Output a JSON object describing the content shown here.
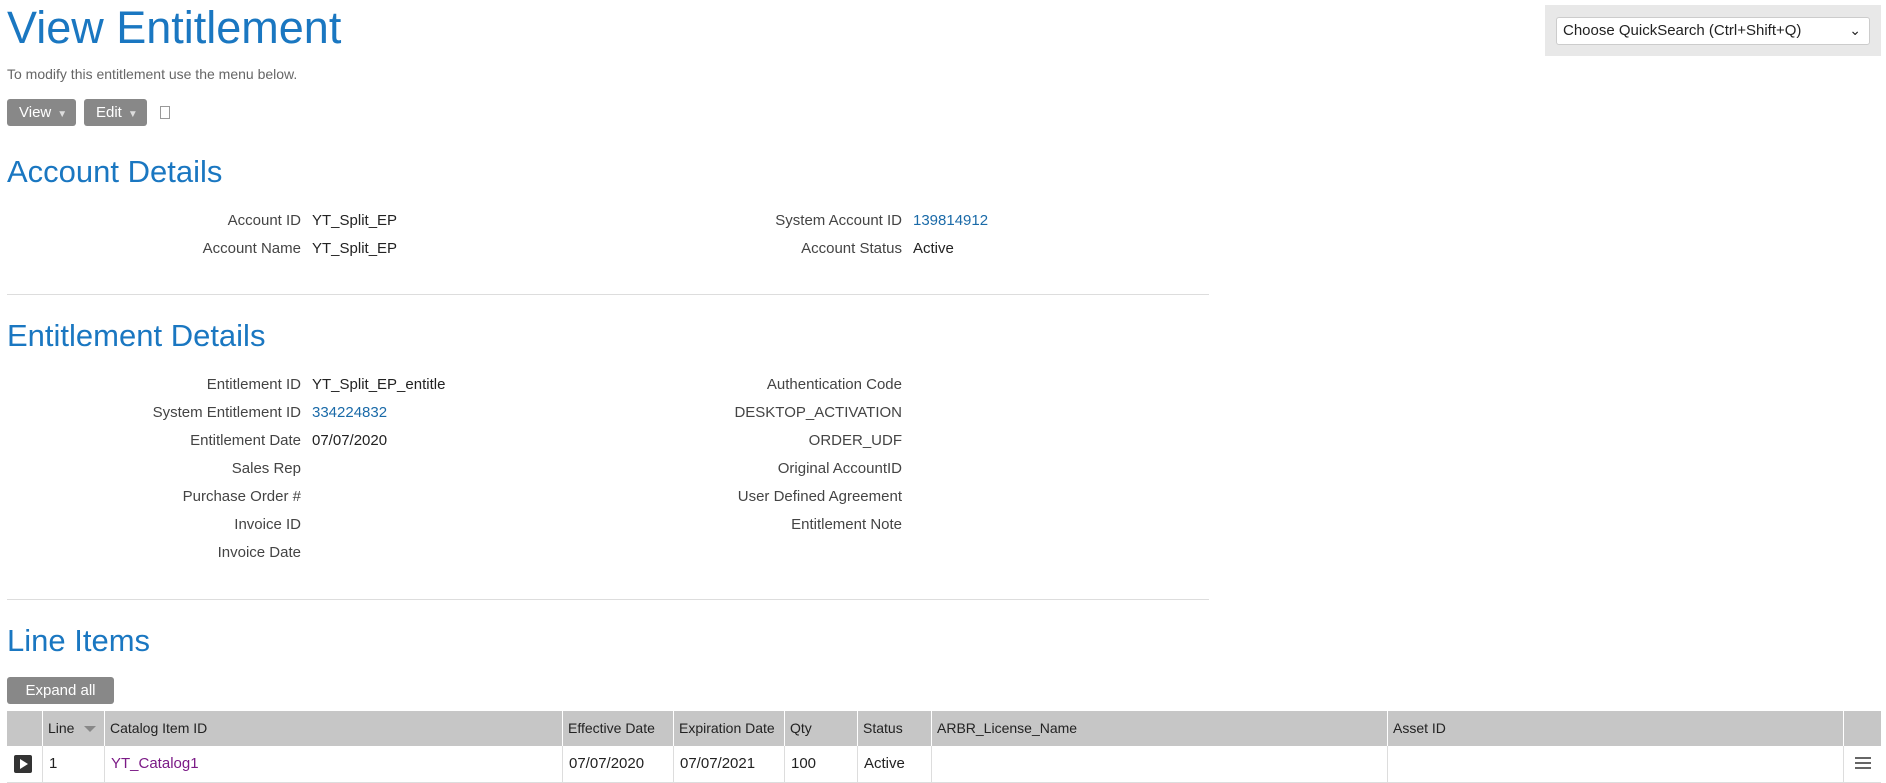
{
  "page": {
    "title": "View Entitlement",
    "subtitle": "To modify this entitlement use the menu below."
  },
  "quicksearch": {
    "label": "Choose QuickSearch (Ctrl+Shift+Q)"
  },
  "menu": {
    "view_label": "View",
    "edit_label": "Edit"
  },
  "account": {
    "heading": "Account Details",
    "account_id_label": "Account ID",
    "account_id": "YT_Split_EP",
    "account_name_label": "Account Name",
    "account_name": "YT_Split_EP",
    "system_account_id_label": "System Account ID",
    "system_account_id": "139814912",
    "account_status_label": "Account Status",
    "account_status": "Active"
  },
  "entitlement": {
    "heading": "Entitlement Details",
    "entitlement_id_label": "Entitlement ID",
    "entitlement_id": "YT_Split_EP_entitle",
    "system_entitlement_id_label": "System Entitlement ID",
    "system_entitlement_id": "334224832",
    "entitlement_date_label": "Entitlement Date",
    "entitlement_date": "07/07/2020",
    "sales_rep_label": "Sales Rep",
    "purchase_order_label": "Purchase Order #",
    "invoice_id_label": "Invoice ID",
    "invoice_date_label": "Invoice Date",
    "authentication_code_label": "Authentication Code",
    "desktop_activation_label": "DESKTOP_ACTIVATION",
    "order_udf_label": "ORDER_UDF",
    "original_account_id_label": "Original AccountID",
    "user_defined_agreement_label": "User Defined Agreement",
    "entitlement_note_label": "Entitlement Note"
  },
  "line_items": {
    "heading": "Line Items",
    "expand_all_label": "Expand all",
    "columns": {
      "line": "Line",
      "catalog_item_id": "Catalog Item ID",
      "effective_date": "Effective Date",
      "expiration_date": "Expiration Date",
      "qty": "Qty",
      "status": "Status",
      "arbr_license_name": "ARBR_License_Name",
      "asset_id": "Asset ID"
    },
    "rows": [
      {
        "line": "1",
        "catalog_item_id": "YT_Catalog1",
        "effective_date": "07/07/2020",
        "expiration_date": "07/07/2021",
        "qty": "100",
        "status": "Active",
        "arbr_license_name": "",
        "asset_id": ""
      }
    ]
  },
  "icons": {
    "dropdown": "chevron-down-icon",
    "menu_arrow": "caret-down-icon",
    "clipboard": "clipboard-icon",
    "expand_row": "play-icon",
    "sort": "sort-desc-icon",
    "row_menu": "list-menu-icon"
  },
  "colors": {
    "heading": "#1a77c1",
    "link": "#1a6aa8",
    "visited_link": "#7b1a86",
    "button": "#888888",
    "grid_header": "#c6c6c6"
  }
}
